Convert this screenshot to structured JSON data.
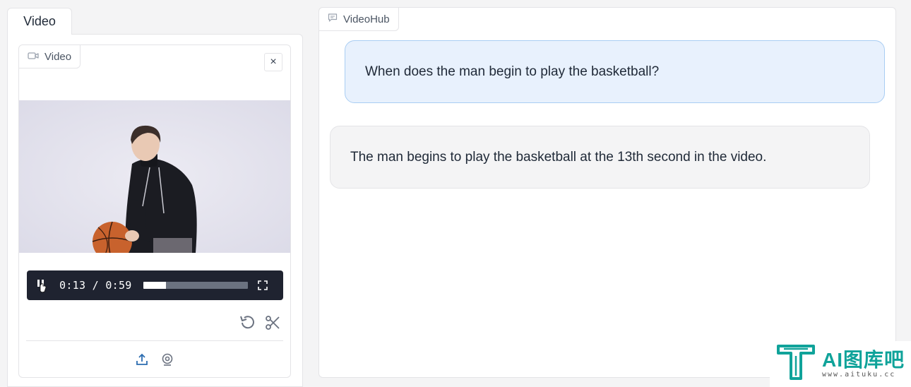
{
  "left_tab": {
    "label": "Video"
  },
  "video_block": {
    "label": "Video",
    "clear_symbol": "×",
    "player": {
      "time_display": "0:13 / 0:59",
      "progress_fraction": 0.22
    }
  },
  "chat": {
    "label": "VideoHub",
    "messages": [
      {
        "role": "user",
        "text": "When does the man begin to play the basketball?"
      },
      {
        "role": "bot",
        "text": "The man begins to play the basketball at the 13th second in the video."
      }
    ]
  },
  "watermark": {
    "main": "AI图库吧",
    "sub": "www.aituku.cc"
  },
  "colors": {
    "accent": "#10a39a",
    "user_bubble": "#e8f1fd",
    "user_border": "#a9cdf3"
  }
}
